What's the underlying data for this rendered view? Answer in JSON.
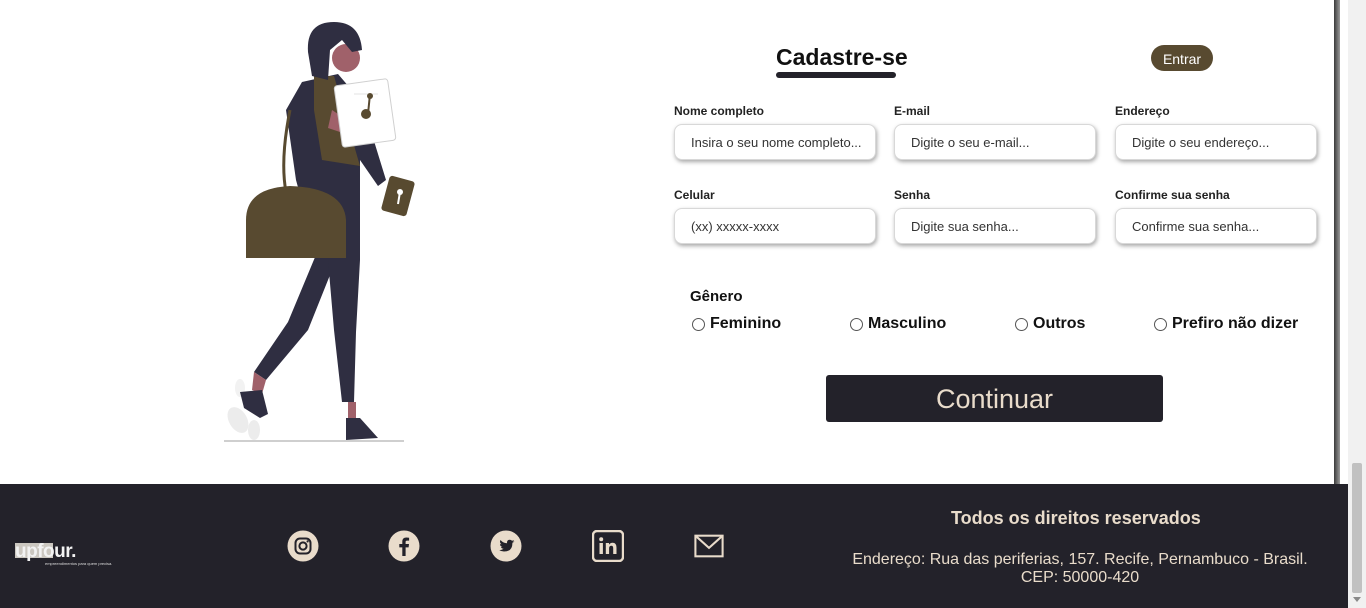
{
  "form": {
    "title": "Cadastre-se",
    "enter_label": "Entrar",
    "fields": [
      {
        "label": "Nome completo",
        "placeholder": "Insira o seu nome completo..."
      },
      {
        "label": "E-mail",
        "placeholder": "Digite o seu e-mail..."
      },
      {
        "label": "Endereço",
        "placeholder": "Digite o seu endereço..."
      },
      {
        "label": "Celular",
        "placeholder": "(xx) xxxxx-xxxx"
      },
      {
        "label": "Senha",
        "placeholder": "Digite sua senha..."
      },
      {
        "label": "Confirme sua senha",
        "placeholder": "Confirme sua senha..."
      }
    ],
    "gender": {
      "label": "Gênero",
      "options": [
        "Feminino",
        "Masculino",
        "Outros",
        "Prefiro não dizer"
      ]
    },
    "continue_label": "Continuar"
  },
  "footer": {
    "logo": {
      "text": "upfour.",
      "tagline": "empreendimentos para quem precisa."
    },
    "social_icons": [
      "instagram-icon",
      "facebook-icon",
      "twitter-icon",
      "linkedin-icon",
      "mail-icon"
    ],
    "rights": "Todos os direitos reservados",
    "address_line1": "Endereço: Rua das periferias, 157. Recife, Pernambuco - Brasil.",
    "address_line2": "CEP: 50000-420"
  },
  "colors": {
    "accent_brown": "#584a30",
    "dark": "#23222a",
    "footer_text": "#e9dccb",
    "skin": "#a0616a"
  }
}
